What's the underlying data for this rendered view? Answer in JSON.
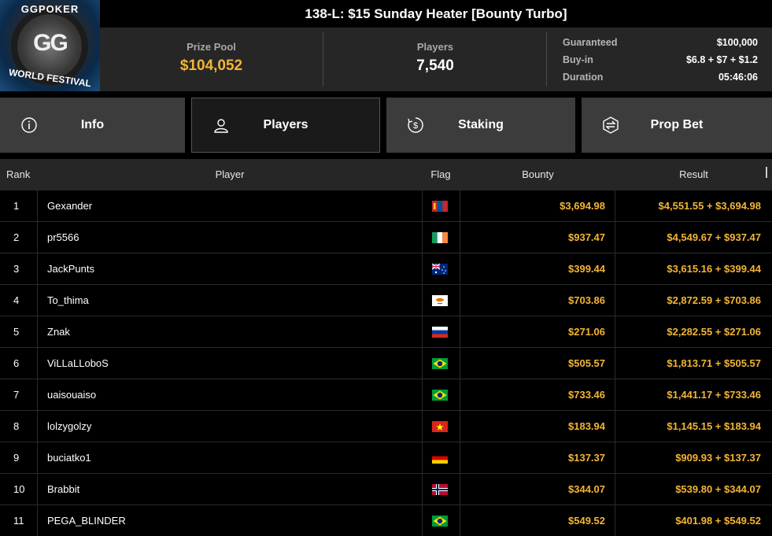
{
  "header": {
    "logo": {
      "top_text": "GGPOKER",
      "bottom_text": "WORLD FESTIVAL",
      "mark": "GG"
    },
    "title": "138-L: $15 Sunday Heater [Bounty Turbo]",
    "prize_pool_label": "Prize Pool",
    "prize_pool": "$104,052",
    "players_label": "Players",
    "players": "7,540",
    "details": [
      {
        "key": "Guaranteed",
        "value": "$100,000"
      },
      {
        "key": "Buy-in",
        "value": "$6.8 + $7 + $1.2"
      },
      {
        "key": "Duration",
        "value": "05:46:06"
      }
    ]
  },
  "tabs": [
    {
      "label": "Info",
      "icon": "info-icon"
    },
    {
      "label": "Players",
      "icon": "user-icon",
      "active": true
    },
    {
      "label": "Staking",
      "icon": "staking-icon"
    },
    {
      "label": "Prop Bet",
      "icon": "prop-bet-icon"
    }
  ],
  "table": {
    "headers": {
      "rank": "Rank",
      "player": "Player",
      "flag": "Flag",
      "bounty": "Bounty",
      "result": "Result"
    },
    "rows": [
      {
        "rank": "1",
        "player": "Gexander",
        "flag": "mongolia",
        "bounty": "$3,694.98",
        "result": "$4,551.55 + $3,694.98"
      },
      {
        "rank": "2",
        "player": "pr5566",
        "flag": "ireland",
        "bounty": "$937.47",
        "result": "$4,549.67 + $937.47"
      },
      {
        "rank": "3",
        "player": "JackPunts",
        "flag": "australia",
        "bounty": "$399.44",
        "result": "$3,615.16 + $399.44"
      },
      {
        "rank": "4",
        "player": "To_thima",
        "flag": "cyprus",
        "bounty": "$703.86",
        "result": "$2,872.59 + $703.86"
      },
      {
        "rank": "5",
        "player": "Znak",
        "flag": "russia",
        "bounty": "$271.06",
        "result": "$2,282.55 + $271.06"
      },
      {
        "rank": "6",
        "player": "ViLLaLLoboS",
        "flag": "brazil",
        "bounty": "$505.57",
        "result": "$1,813.71 + $505.57"
      },
      {
        "rank": "7",
        "player": "uaisouaiso",
        "flag": "brazil",
        "bounty": "$733.46",
        "result": "$1,441.17 + $733.46"
      },
      {
        "rank": "8",
        "player": "lolzygolzy",
        "flag": "vietnam",
        "bounty": "$183.94",
        "result": "$1,145.15 + $183.94"
      },
      {
        "rank": "9",
        "player": "buciatko1",
        "flag": "germany",
        "bounty": "$137.37",
        "result": "$909.93 + $137.37"
      },
      {
        "rank": "10",
        "player": "Brabbit",
        "flag": "norway",
        "bounty": "$344.07",
        "result": "$539.80 + $344.07"
      },
      {
        "rank": "11",
        "player": "PEGA_BLINDER",
        "flag": "brazil",
        "bounty": "$549.52",
        "result": "$401.98 + $549.52"
      }
    ]
  },
  "colors": {
    "accent_gold": "#f3b534",
    "panel": "#262626",
    "tab": "#3c3c3c"
  }
}
